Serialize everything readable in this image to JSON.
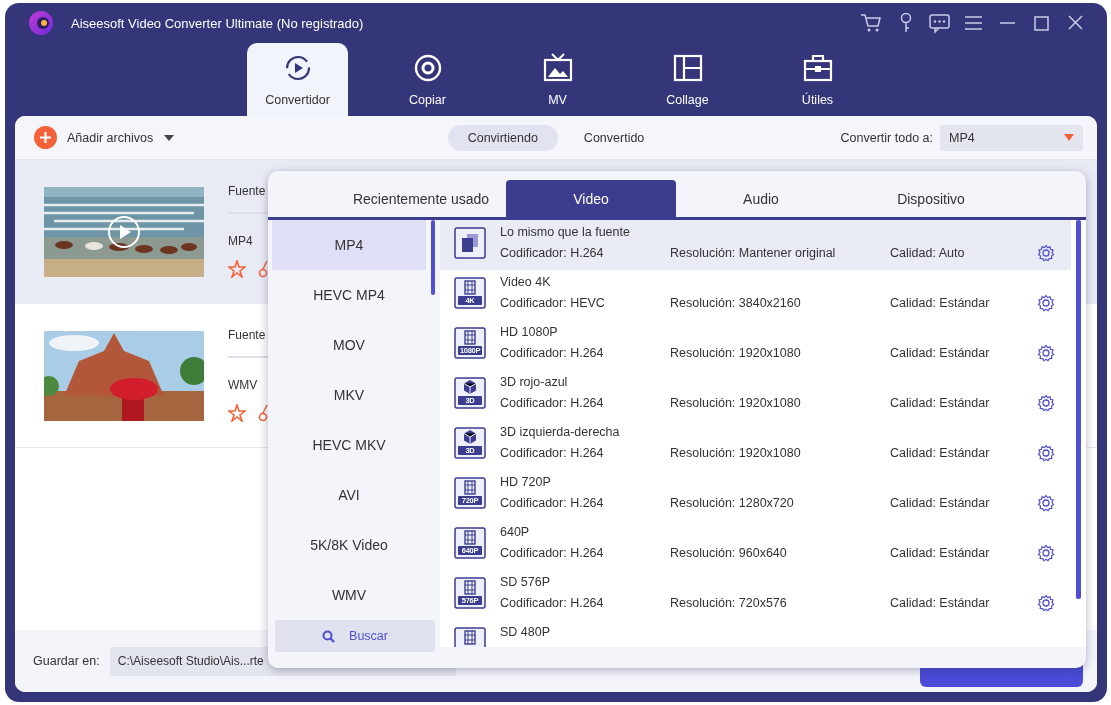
{
  "window": {
    "title": "Aiseesoft Video Converter Ultimate (No registrado)"
  },
  "nav_tabs": [
    {
      "label": "Convertidor",
      "kind": "convert",
      "selected": true
    },
    {
      "label": "Copiar",
      "kind": "disc",
      "selected": false
    },
    {
      "label": "MV",
      "kind": "tv",
      "selected": false
    },
    {
      "label": "Collage",
      "kind": "grid",
      "selected": false
    },
    {
      "label": "Útiles",
      "kind": "toolbox",
      "selected": false
    }
  ],
  "toolbar": {
    "add_label": "Añadir archivos",
    "tabs": [
      {
        "label": "Convirtiendo",
        "selected": true
      },
      {
        "label": "Convertido",
        "selected": false
      }
    ],
    "convert_all_label": "Convertir todo a:",
    "format": "MP4"
  },
  "files": [
    {
      "source_label": "Fuente",
      "format": "MP4",
      "selected": true
    },
    {
      "source_label": "Fuente",
      "format": "WMV",
      "selected": false
    }
  ],
  "format_popup": {
    "tabs": [
      {
        "label": "Recientemente usado",
        "selected": false
      },
      {
        "label": "Video",
        "selected": true
      },
      {
        "label": "Audio",
        "selected": false
      },
      {
        "label": "Dispositivo",
        "selected": false
      }
    ],
    "formats": [
      {
        "label": "MP4",
        "selected": true
      },
      {
        "label": "HEVC MP4",
        "selected": false
      },
      {
        "label": "MOV",
        "selected": false
      },
      {
        "label": "MKV",
        "selected": false
      },
      {
        "label": "HEVC MKV",
        "selected": false
      },
      {
        "label": "AVI",
        "selected": false
      },
      {
        "label": "5K/8K Video",
        "selected": false
      },
      {
        "label": "WMV",
        "selected": false
      }
    ],
    "search_label": "Buscar",
    "presets": [
      {
        "name": "Lo mismo que la fuente",
        "kind": "same",
        "encoder": "Codificador: H.264",
        "resolution": "Resolución: Mantener original",
        "quality": "Calidad: Auto",
        "selected": true
      },
      {
        "name": "Video 4K",
        "kind": "film",
        "badge": "4K",
        "encoder": "Codificador: HEVC",
        "resolution": "Resolución: 3840x2160",
        "quality": "Calidad: Estándar",
        "selected": false
      },
      {
        "name": "HD 1080P",
        "kind": "film",
        "badge": "1080P",
        "encoder": "Codificador: H.264",
        "resolution": "Resolución: 1920x1080",
        "quality": "Calidad: Estándar",
        "selected": false
      },
      {
        "name": "3D rojo-azul",
        "kind": "cube",
        "badge": "3D",
        "encoder": "Codificador: H.264",
        "resolution": "Resolución: 1920x1080",
        "quality": "Calidad: Estándar",
        "selected": false
      },
      {
        "name": "3D izquierda-derecha",
        "kind": "cube",
        "badge": "3D",
        "encoder": "Codificador: H.264",
        "resolution": "Resolución: 1920x1080",
        "quality": "Calidad: Estándar",
        "selected": false
      },
      {
        "name": "HD 720P",
        "kind": "film",
        "badge": "720P",
        "encoder": "Codificador: H.264",
        "resolution": "Resolución: 1280x720",
        "quality": "Calidad: Estándar",
        "selected": false
      },
      {
        "name": "640P",
        "kind": "film",
        "badge": "640P",
        "encoder": "Codificador: H.264",
        "resolution": "Resolución: 960x640",
        "quality": "Calidad: Estándar",
        "selected": false
      },
      {
        "name": "SD 576P",
        "kind": "film",
        "badge": "576P",
        "encoder": "Codificador: H.264",
        "resolution": "Resolución: 720x576",
        "quality": "Calidad: Estándar",
        "selected": false
      },
      {
        "name": "SD 480P",
        "kind": "film",
        "selected": false
      }
    ]
  },
  "bottom_bar": {
    "save_label": "Guardar en:",
    "path": "C:\\Aiseesoft Studio\\Ais...rte"
  }
}
